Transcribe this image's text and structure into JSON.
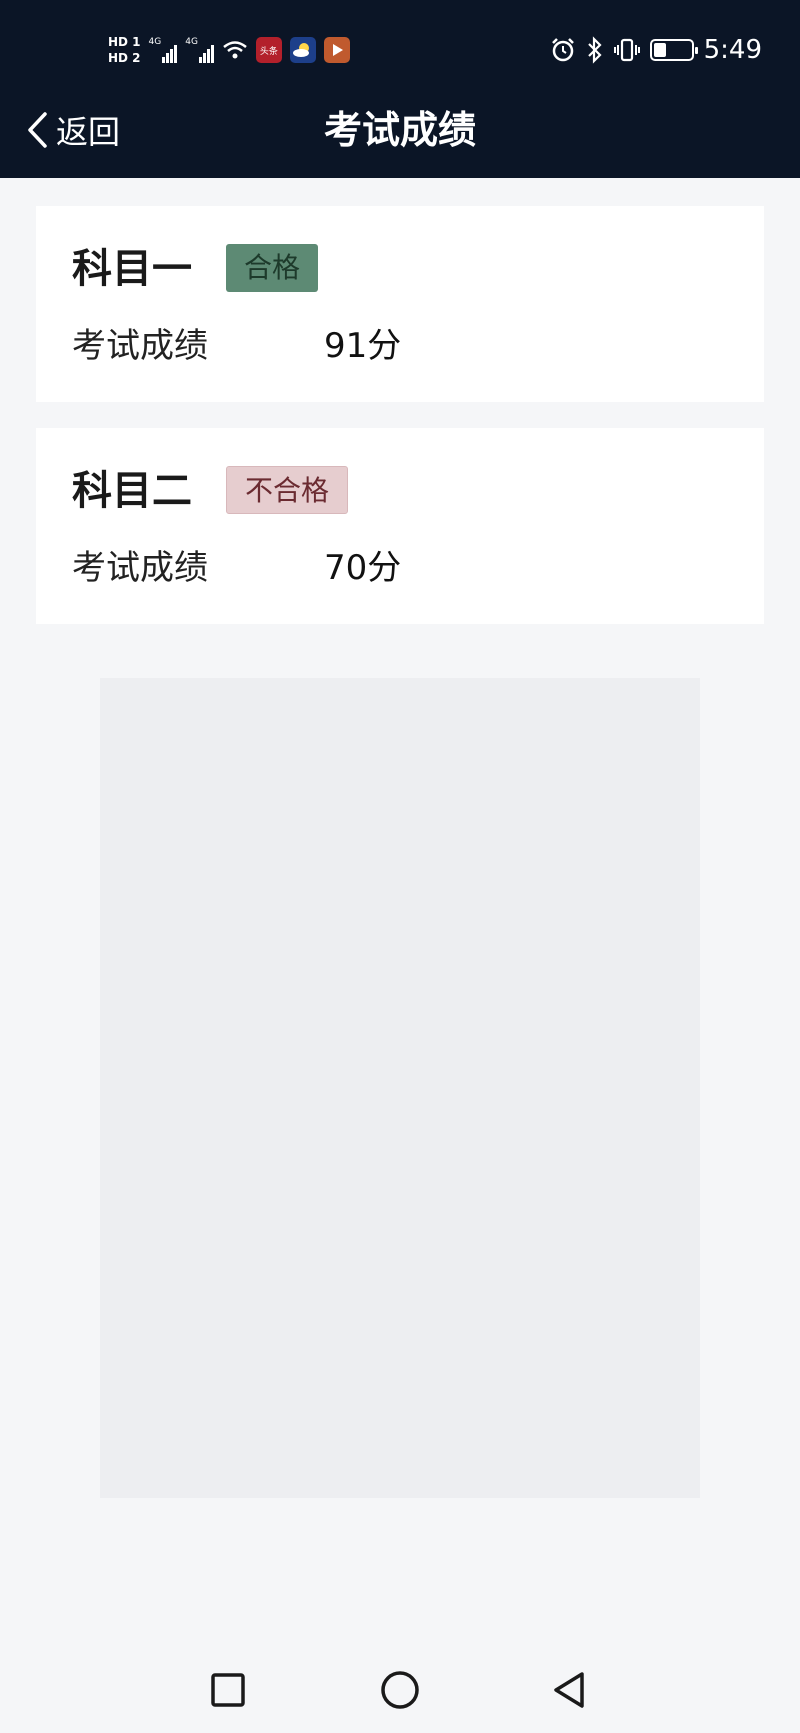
{
  "status_bar": {
    "hd_top": "HD 1",
    "hd_bottom": "HD 2",
    "signal1_label": "4G",
    "signal2_label": "4G",
    "app1_label": "头条",
    "time": "5:49",
    "battery_level": 0.35
  },
  "nav": {
    "back_label": "返回",
    "title": "考试成绩"
  },
  "results": [
    {
      "subject": "科目一",
      "status": "合格",
      "score_label": "考试成绩",
      "score": "91分"
    },
    {
      "subject": "科目二",
      "status": "不合格",
      "score_label": "考试成绩",
      "score": "70分"
    }
  ],
  "colors": {
    "header_bg": "#0b1526",
    "page_bg": "#f5f6f8",
    "pass_badge_bg": "#5d8a74",
    "fail_badge_bg": "#e6cdcf"
  },
  "icons": {
    "back": "chevron-left-icon",
    "recent": "square-icon",
    "home": "circle-icon",
    "sys_back": "triangle-back-icon"
  }
}
